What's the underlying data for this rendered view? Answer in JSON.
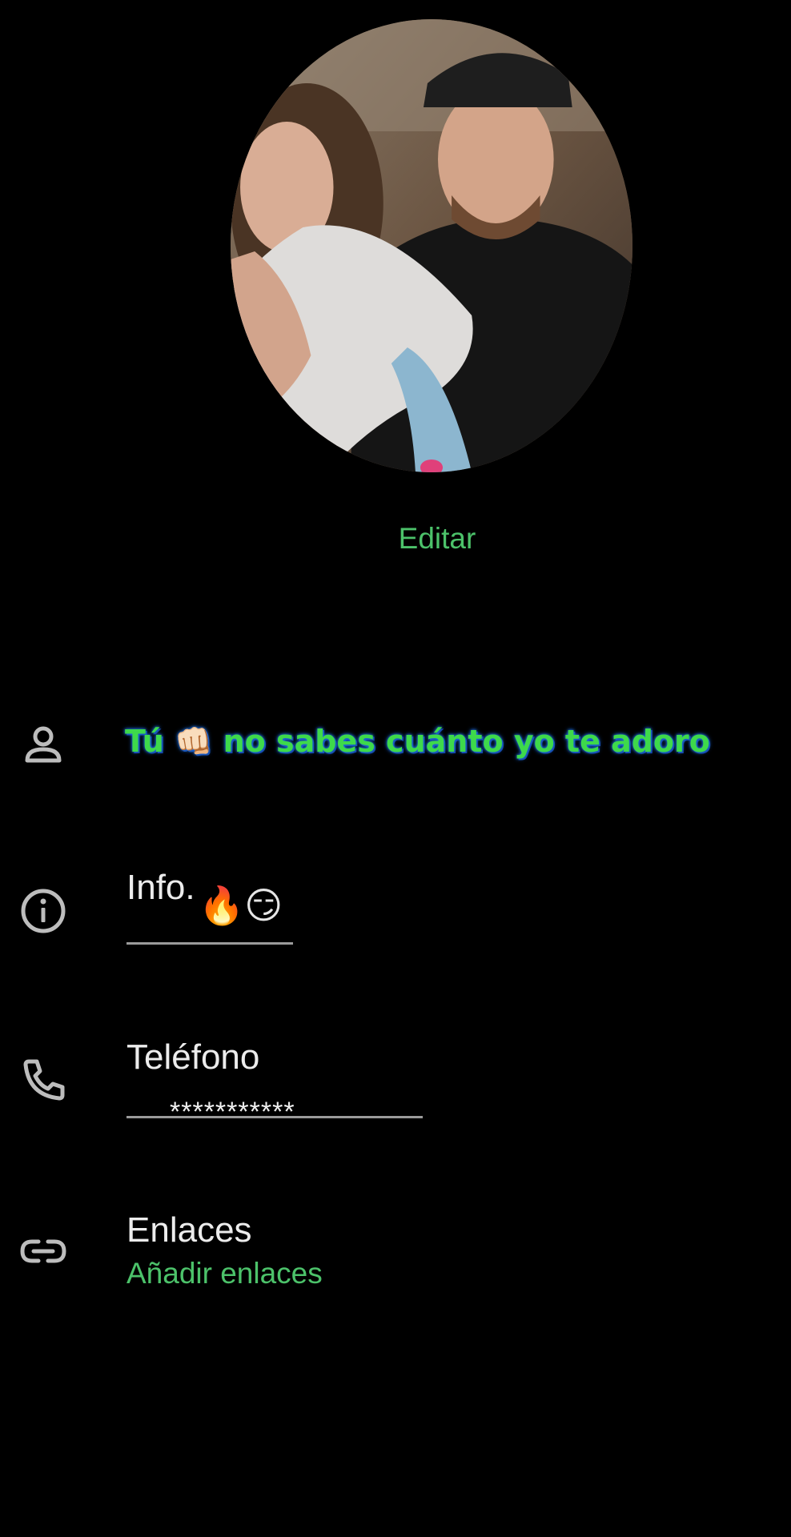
{
  "profile": {
    "edit_label": "Editar"
  },
  "name_row": {
    "icon": "person-icon",
    "text": "Tú 👊🏻 no sabes cuánto yo te adoro"
  },
  "info_row": {
    "icon": "info-icon",
    "label": "Info.",
    "emojis": "🔥😏"
  },
  "phone_row": {
    "icon": "phone-icon",
    "label": "Teléfono",
    "value": "***********"
  },
  "links_row": {
    "icon": "link-icon",
    "label": "Enlaces",
    "action": "Añadir enlaces"
  },
  "colors": {
    "background": "#000000",
    "accent_green": "#4cc26a",
    "name_green": "#3ed94b",
    "name_glow": "#1d6bd8"
  }
}
